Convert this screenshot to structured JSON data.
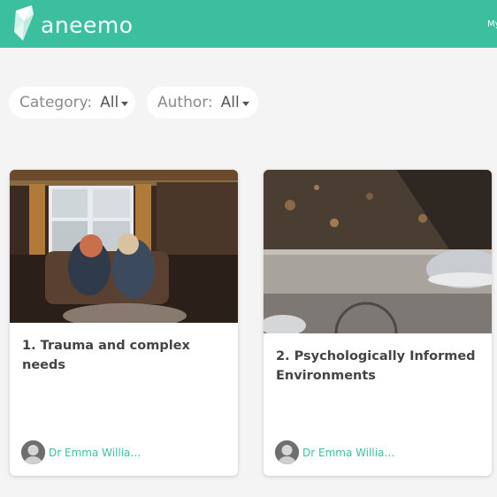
{
  "header": {
    "brand": "aneemo",
    "nav_partial": "My",
    "colors": {
      "brand": "#3cbf9f",
      "background": "#f4f4f4"
    }
  },
  "filters": [
    {
      "label": "Category:",
      "value": "All",
      "icon": "caret-down-icon"
    },
    {
      "label": "Author:",
      "value": "All",
      "icon": "caret-down-icon"
    }
  ],
  "courses": [
    {
      "title": "1. Trauma and complex needs",
      "author": "Dr Emma Williams",
      "image": "two-women-on-sofa-photo"
    },
    {
      "title": "2. Psychologically Informed Environments",
      "author": "Dr Emma Williams",
      "image": "sneakers-on-curb-photo"
    }
  ]
}
